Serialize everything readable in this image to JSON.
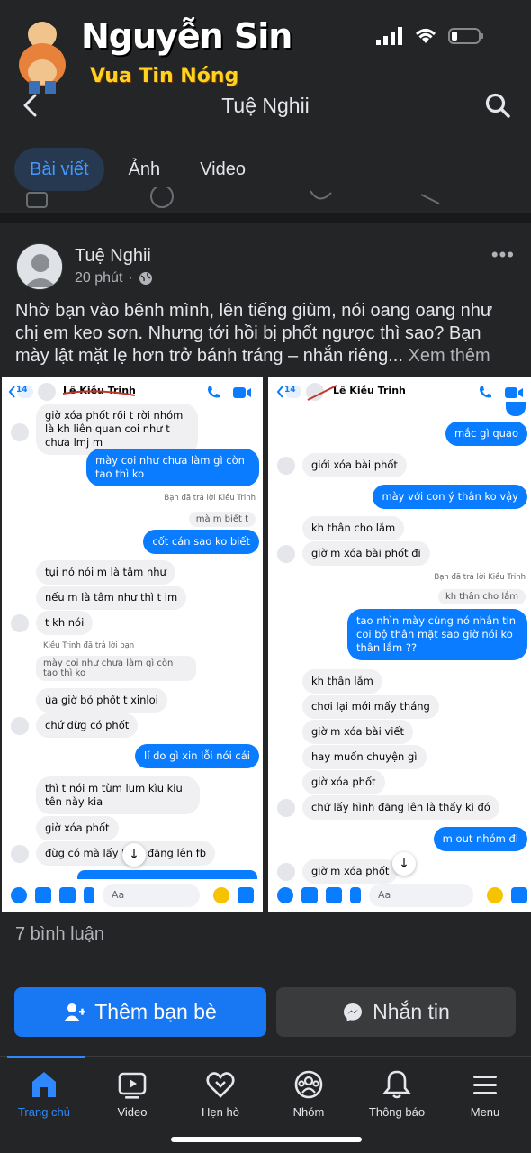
{
  "watermark": {
    "name": "Nguyễn Sin",
    "slogan": "Vua Tin Nóng"
  },
  "header": {
    "title": "Tuệ Nghii",
    "back_icon": "chevron-left-icon",
    "search_icon": "search-icon"
  },
  "tabs": [
    {
      "label": "Bài viết",
      "active": true
    },
    {
      "label": "Ảnh"
    },
    {
      "label": "Video"
    }
  ],
  "post": {
    "author": "Tuệ Nghii",
    "time": "20 phút",
    "privacy_icon": "globe-icon",
    "text": "Nhờ bạn vào bênh mình, lên tiếng giùm, nói oang oang như chị em keo sơn. Nhưng tới hồi bị phốt ngược thì sao? Bạn mày lật mặt lẹ hơn trở bánh tráng – nhắn riêng...",
    "see_more": "Xem thêm"
  },
  "screenshot_left": {
    "back_count": "14",
    "contact": "Lê Kiều Trinh",
    "messages": [
      {
        "text": "giờ xóa phốt rồi t rời nhóm là kh liên quan coi như t chưa lmj m",
        "me": false
      },
      {
        "text": "mày coi như chưa làm gì còn tao thì ko",
        "me": true
      },
      {
        "note": "Bạn đã trả lời Kiều Trinh"
      },
      {
        "text": "mà m biết t",
        "reply": true
      },
      {
        "text": "cốt cán sao ko biết",
        "me": true
      },
      {
        "text": "tụi nó nói m là tâm như",
        "me": false
      },
      {
        "text": "nếu m là tâm như thì t im",
        "me": false
      },
      {
        "text": "t kh nói",
        "me": false
      },
      {
        "note": "Kiều Trinh đã trả lời bạn"
      },
      {
        "text": "mày coi như chưa làm gì còn tao thì ko",
        "reply": true
      },
      {
        "text": "ủa giờ bỏ phốt t xinloi",
        "me": false
      },
      {
        "text": "chứ đừg có phốt",
        "me": false
      },
      {
        "text": "lí do gì xin lỗi nói cái",
        "me": true
      },
      {
        "text": "thì t nói m tùm lum kìu kiu tên này kia",
        "me": false
      },
      {
        "text": "giờ xóa phốt",
        "me": false
      },
      {
        "text": "đừg có mà lấy hình đăng lên fb",
        "me": false
      }
    ],
    "composer_placeholder": "Aa"
  },
  "screenshot_right": {
    "back_count": "14",
    "contact": "Lê Kiều Trinh",
    "messages": [
      {
        "text": "mắc gì quao",
        "me": true
      },
      {
        "text": "giới xóa bài phốt",
        "me": false
      },
      {
        "text": "mày với con ý thân ko vậy",
        "me": true
      },
      {
        "text": "kh thân cho lắm",
        "me": false
      },
      {
        "text": "giờ m xóa bài phốt đi",
        "me": false
      },
      {
        "note": "Bạn đã trả lời Kiều Trinh"
      },
      {
        "text": "kh thân cho lắm",
        "reply": true
      },
      {
        "text": "tao nhìn mày cùng nó nhắn tin coi bộ thân mặt sao giờ nói ko thân lắm ??",
        "me": true
      },
      {
        "text": "kh thân lắm",
        "me": false
      },
      {
        "text": "chơi lại mới mấy tháng",
        "me": false
      },
      {
        "text": "giờ m xóa bài viết",
        "me": false
      },
      {
        "text": "hay muốn chuyện gì",
        "me": false
      },
      {
        "text": "giờ xóa phốt",
        "me": false
      },
      {
        "text": "chứ lấy hình đăng lên là thấy kì đó",
        "me": false
      },
      {
        "text": "m out nhóm đi",
        "me": true
      },
      {
        "text": "giờ m xóa phốt",
        "me": false
      }
    ],
    "composer_placeholder": "Aa"
  },
  "comments": {
    "count_label": "7 bình luận"
  },
  "actions": {
    "add_friend": "Thêm bạn bè",
    "message": "Nhắn tin"
  },
  "nav": [
    {
      "label": "Trang chủ",
      "icon": "home-icon",
      "active": true
    },
    {
      "label": "Video",
      "icon": "video-icon"
    },
    {
      "label": "Hẹn hò",
      "icon": "heart-icon"
    },
    {
      "label": "Nhóm",
      "icon": "groups-icon"
    },
    {
      "label": "Thông báo",
      "icon": "bell-icon"
    },
    {
      "label": "Menu",
      "icon": "menu-icon"
    }
  ],
  "colors": {
    "accent": "#2d88ff",
    "button_blue": "#1877f2",
    "bubble_blue": "#0a7cff",
    "background": "#242526"
  }
}
